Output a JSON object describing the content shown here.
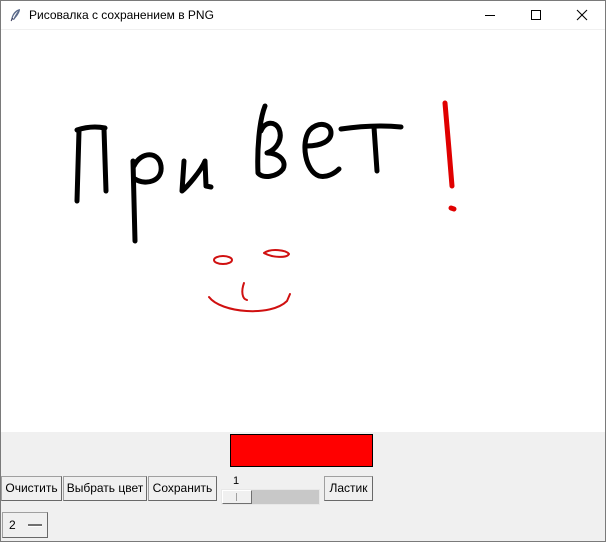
{
  "window": {
    "title": "Рисовалка с сохранением в PNG",
    "app_icon": "feather-icon",
    "controls": [
      "minimize-icon",
      "maximize-icon",
      "close-icon"
    ]
  },
  "canvas": {
    "background": "#ffffff",
    "drawing": {
      "ink_colors": [
        "#000000",
        "#e00000"
      ],
      "handwritten_text": "Привет !"
    }
  },
  "toolbar": {
    "current_color": "#ff0000",
    "clear_label": "Очистить",
    "choose_color_label": "Выбрать цвет",
    "save_label": "Сохранить",
    "brush_size_value": "1",
    "eraser_label": "Ластик",
    "option_value": "2"
  }
}
